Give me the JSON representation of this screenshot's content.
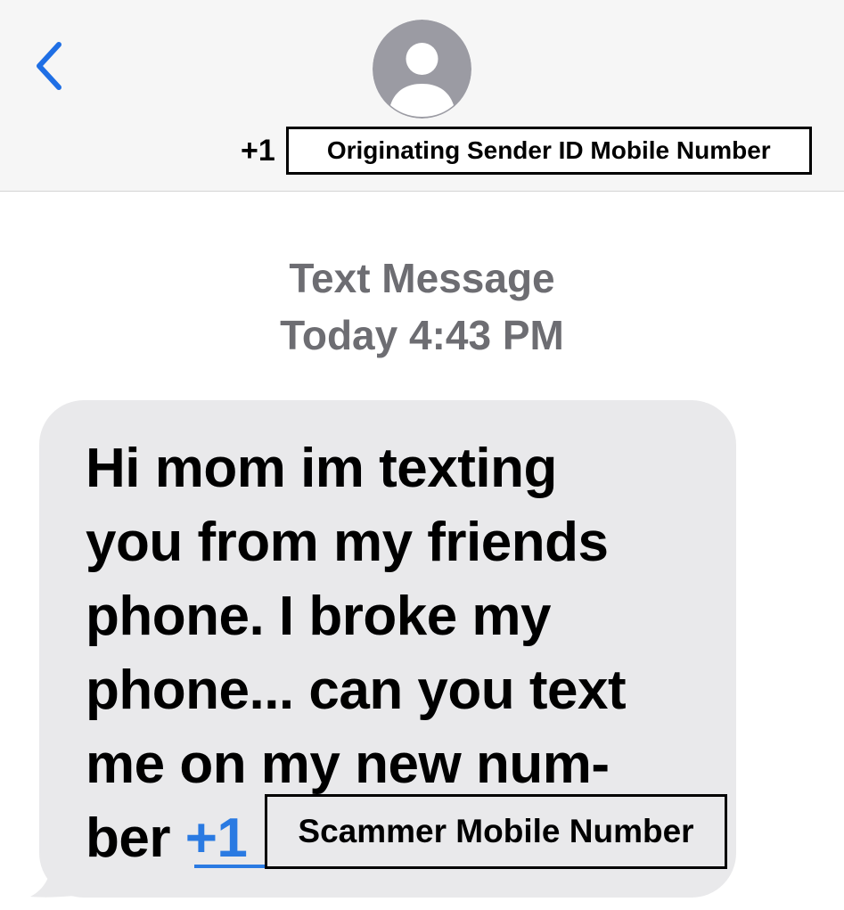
{
  "header": {
    "back_icon": "chevron-left-icon",
    "avatar_icon": "person-icon",
    "sender_prefix": "+1",
    "sender_redaction_label": "Originating Sender ID Mobile Number"
  },
  "thread": {
    "message_type": "Text Message",
    "timestamp": "Today 4:43 PM"
  },
  "message": {
    "lines": [
      "Hi mom im texting",
      "you from my friends",
      "phone. I broke my",
      "phone... can you text",
      "me on my new num-"
    ],
    "last_line_text": "ber",
    "link_prefix": "+1",
    "scammer_redaction_label": "Scammer Mobile Number"
  },
  "colors": {
    "accent_blue": "#2a7ae2",
    "bubble_gray": "#e9e9eb",
    "header_bg": "#f6f6f6",
    "meta_gray": "#6d6d72",
    "avatar_gray": "#9b9ba3"
  }
}
